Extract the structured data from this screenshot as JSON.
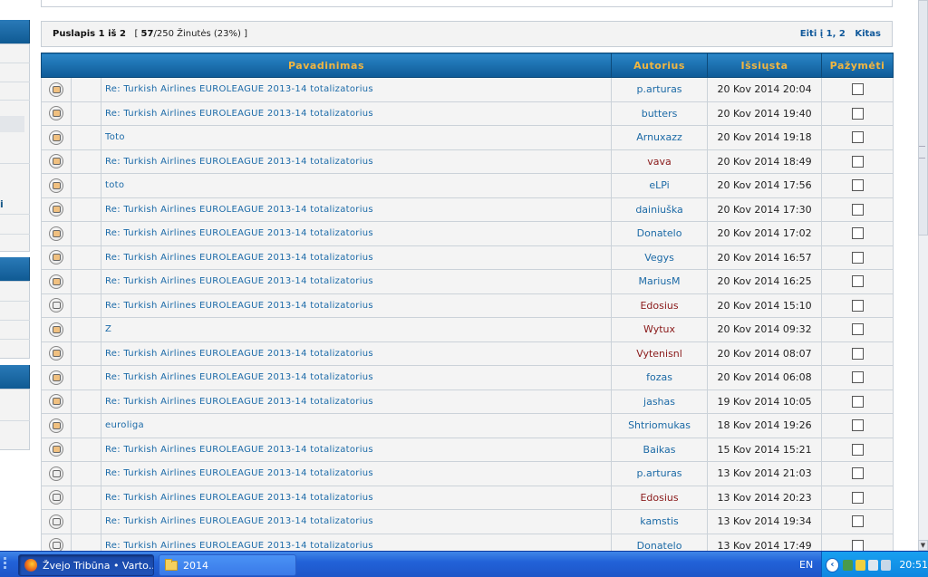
{
  "pagination": {
    "page_word": "Puslapis",
    "page_current": "1",
    "page_of": "iš",
    "page_total": "2",
    "msgs_open": "[",
    "msgs_shown": "57",
    "msgs_total": "/250",
    "msgs_label": "Žinutės",
    "msgs_percent": "(23%)",
    "msgs_close": "]",
    "goto_label": "Eiti į",
    "goto_page1": "1,",
    "goto_page2": "2",
    "next_label": "Kitas"
  },
  "columns": {
    "title": "Pavadinimas",
    "author": "Autorius",
    "sent": "Išsiųsta",
    "mark": "Pažymėti"
  },
  "rows": [
    {
      "title": "Re: Turkish Airlines EUROLEAGUE 2013-14 totalizatorius",
      "author": "p.arturas",
      "author_color": "blue",
      "date": "20 Kov 2014 20:04",
      "icon": "unread"
    },
    {
      "title": "Re: Turkish Airlines EUROLEAGUE 2013-14 totalizatorius",
      "author": "butters",
      "author_color": "blue",
      "date": "20 Kov 2014 19:40",
      "icon": "unread"
    },
    {
      "title": "Toto",
      "author": "Arnuxazz",
      "author_color": "blue",
      "date": "20 Kov 2014 19:18",
      "icon": "unread"
    },
    {
      "title": "Re: Turkish Airlines EUROLEAGUE 2013-14 totalizatorius",
      "author": "vava",
      "author_color": "red",
      "date": "20 Kov 2014 18:49",
      "icon": "unread"
    },
    {
      "title": "toto",
      "author": "eLPi",
      "author_color": "blue",
      "date": "20 Kov 2014 17:56",
      "icon": "unread"
    },
    {
      "title": "Re: Turkish Airlines EUROLEAGUE 2013-14 totalizatorius",
      "author": "dainiuška",
      "author_color": "blue",
      "date": "20 Kov 2014 17:30",
      "icon": "unread"
    },
    {
      "title": "Re: Turkish Airlines EUROLEAGUE 2013-14 totalizatorius",
      "author": "Donatelo",
      "author_color": "blue",
      "date": "20 Kov 2014 17:02",
      "icon": "unread"
    },
    {
      "title": "Re: Turkish Airlines EUROLEAGUE 2013-14 totalizatorius",
      "author": "Vegys",
      "author_color": "blue",
      "date": "20 Kov 2014 16:57",
      "icon": "unread"
    },
    {
      "title": "Re: Turkish Airlines EUROLEAGUE 2013-14 totalizatorius",
      "author": "MariusM",
      "author_color": "blue",
      "date": "20 Kov 2014 16:25",
      "icon": "unread"
    },
    {
      "title": "Re: Turkish Airlines EUROLEAGUE 2013-14 totalizatorius",
      "author": "Edosius",
      "author_color": "red",
      "date": "20 Kov 2014 15:10",
      "icon": "read"
    },
    {
      "title": "Z",
      "author": "Wytux",
      "author_color": "red",
      "date": "20 Kov 2014 09:32",
      "icon": "unread"
    },
    {
      "title": "Re: Turkish Airlines EUROLEAGUE 2013-14 totalizatorius",
      "author": "Vytenisnl",
      "author_color": "red",
      "date": "20 Kov 2014 08:07",
      "icon": "unread"
    },
    {
      "title": "Re: Turkish Airlines EUROLEAGUE 2013-14 totalizatorius",
      "author": "fozas",
      "author_color": "blue",
      "date": "20 Kov 2014 06:08",
      "icon": "unread"
    },
    {
      "title": "Re: Turkish Airlines EUROLEAGUE 2013-14 totalizatorius",
      "author": "jashas",
      "author_color": "blue",
      "date": "19 Kov 2014 10:05",
      "icon": "unread"
    },
    {
      "title": "euroliga",
      "author": "Shtriomukas",
      "author_color": "blue",
      "date": "18 Kov 2014 19:26",
      "icon": "unread"
    },
    {
      "title": "Re: Turkish Airlines EUROLEAGUE 2013-14 totalizatorius",
      "author": "Baikas",
      "author_color": "blue",
      "date": "15 Kov 2014 15:21",
      "icon": "unread"
    },
    {
      "title": "Re: Turkish Airlines EUROLEAGUE 2013-14 totalizatorius",
      "author": "p.arturas",
      "author_color": "blue",
      "date": "13 Kov 2014 21:03",
      "icon": "read"
    },
    {
      "title": "Re: Turkish Airlines EUROLEAGUE 2013-14 totalizatorius",
      "author": "Edosius",
      "author_color": "red",
      "date": "13 Kov 2014 20:23",
      "icon": "read"
    },
    {
      "title": "Re: Turkish Airlines EUROLEAGUE 2013-14 totalizatorius",
      "author": "kamstis",
      "author_color": "blue",
      "date": "13 Kov 2014 19:34",
      "icon": "read"
    },
    {
      "title": "Re: Turkish Airlines EUROLEAGUE 2013-14 totalizatorius",
      "author": "Donatelo",
      "author_color": "blue",
      "date": "13 Kov 2014 17:49",
      "icon": "read"
    }
  ],
  "sidebar": {
    "letter": "i"
  },
  "taskbar": {
    "firefox_task": "Žvejo Tribūna • Varto...",
    "folder_task": "2014",
    "language": "EN",
    "clock": "20:51"
  }
}
